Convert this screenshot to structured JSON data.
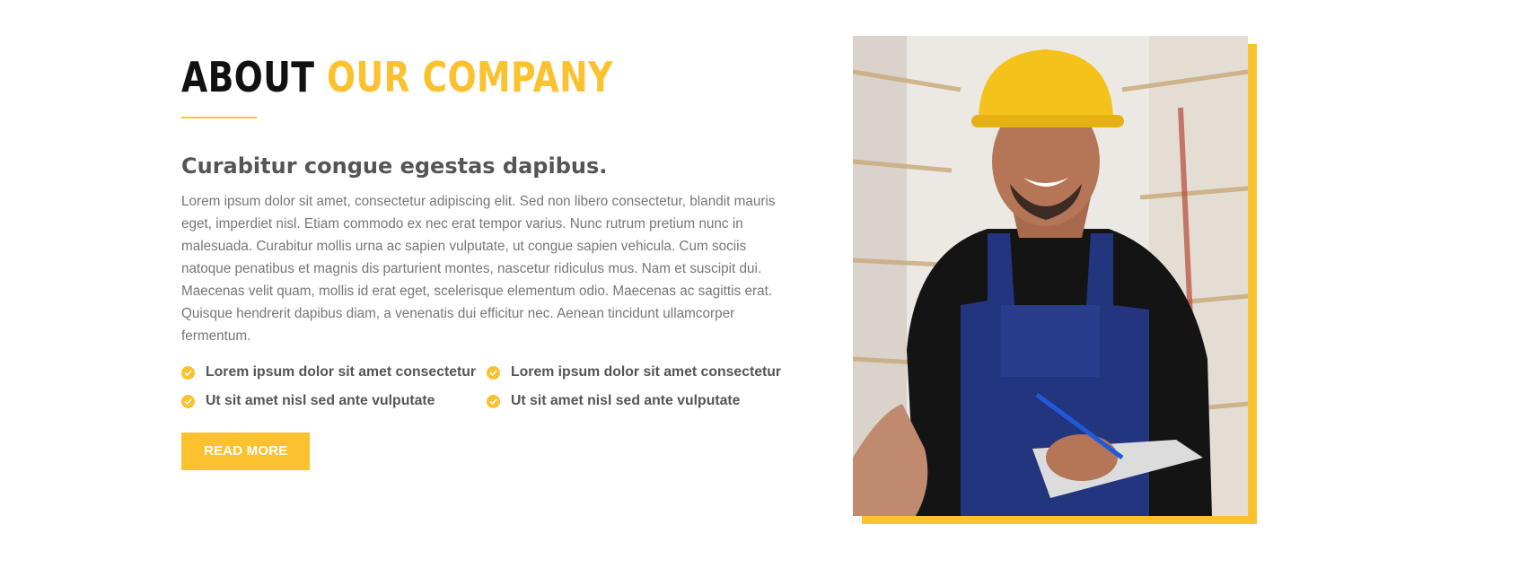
{
  "section": {
    "title_dark": "ABOUT",
    "title_accent": "OUR COMPANY",
    "subtitle": "Curabitur congue egestas dapibus.",
    "body": "Lorem ipsum dolor sit amet, consectetur adipiscing elit. Sed non libero consectetur, blandit mauris eget, imperdiet nisl. Etiam commodo ex nec erat tempor varius. Nunc rutrum pretium nunc in malesuada. Curabitur mollis urna ac sapien vulputate, ut congue sapien vehicula. Cum sociis natoque penatibus et magnis dis parturient montes, nascetur ridiculus mus. Nam et suscipit dui. Maecenas velit quam, mollis id erat eget, scelerisque elementum odio. Maecenas ac sagittis erat. Quisque hendrerit dapibus diam, a venenatis dui efficitur nec. Aenean tincidunt ullamcorper fermentum.",
    "features": [
      "Lorem ipsum dolor sit amet consectetur",
      "Lorem ipsum dolor sit amet consectetur",
      "Ut sit amet nisl sed ante vulputate",
      "Ut sit amet nisl sed ante vulputate"
    ],
    "button_label": "READ MORE",
    "feature_icon": "check-circle-icon",
    "photo": "worker-hardhat-photo"
  },
  "colors": {
    "accent": "#fcc12f",
    "heading": "#111111",
    "subheading": "#555555",
    "body": "#777777"
  }
}
